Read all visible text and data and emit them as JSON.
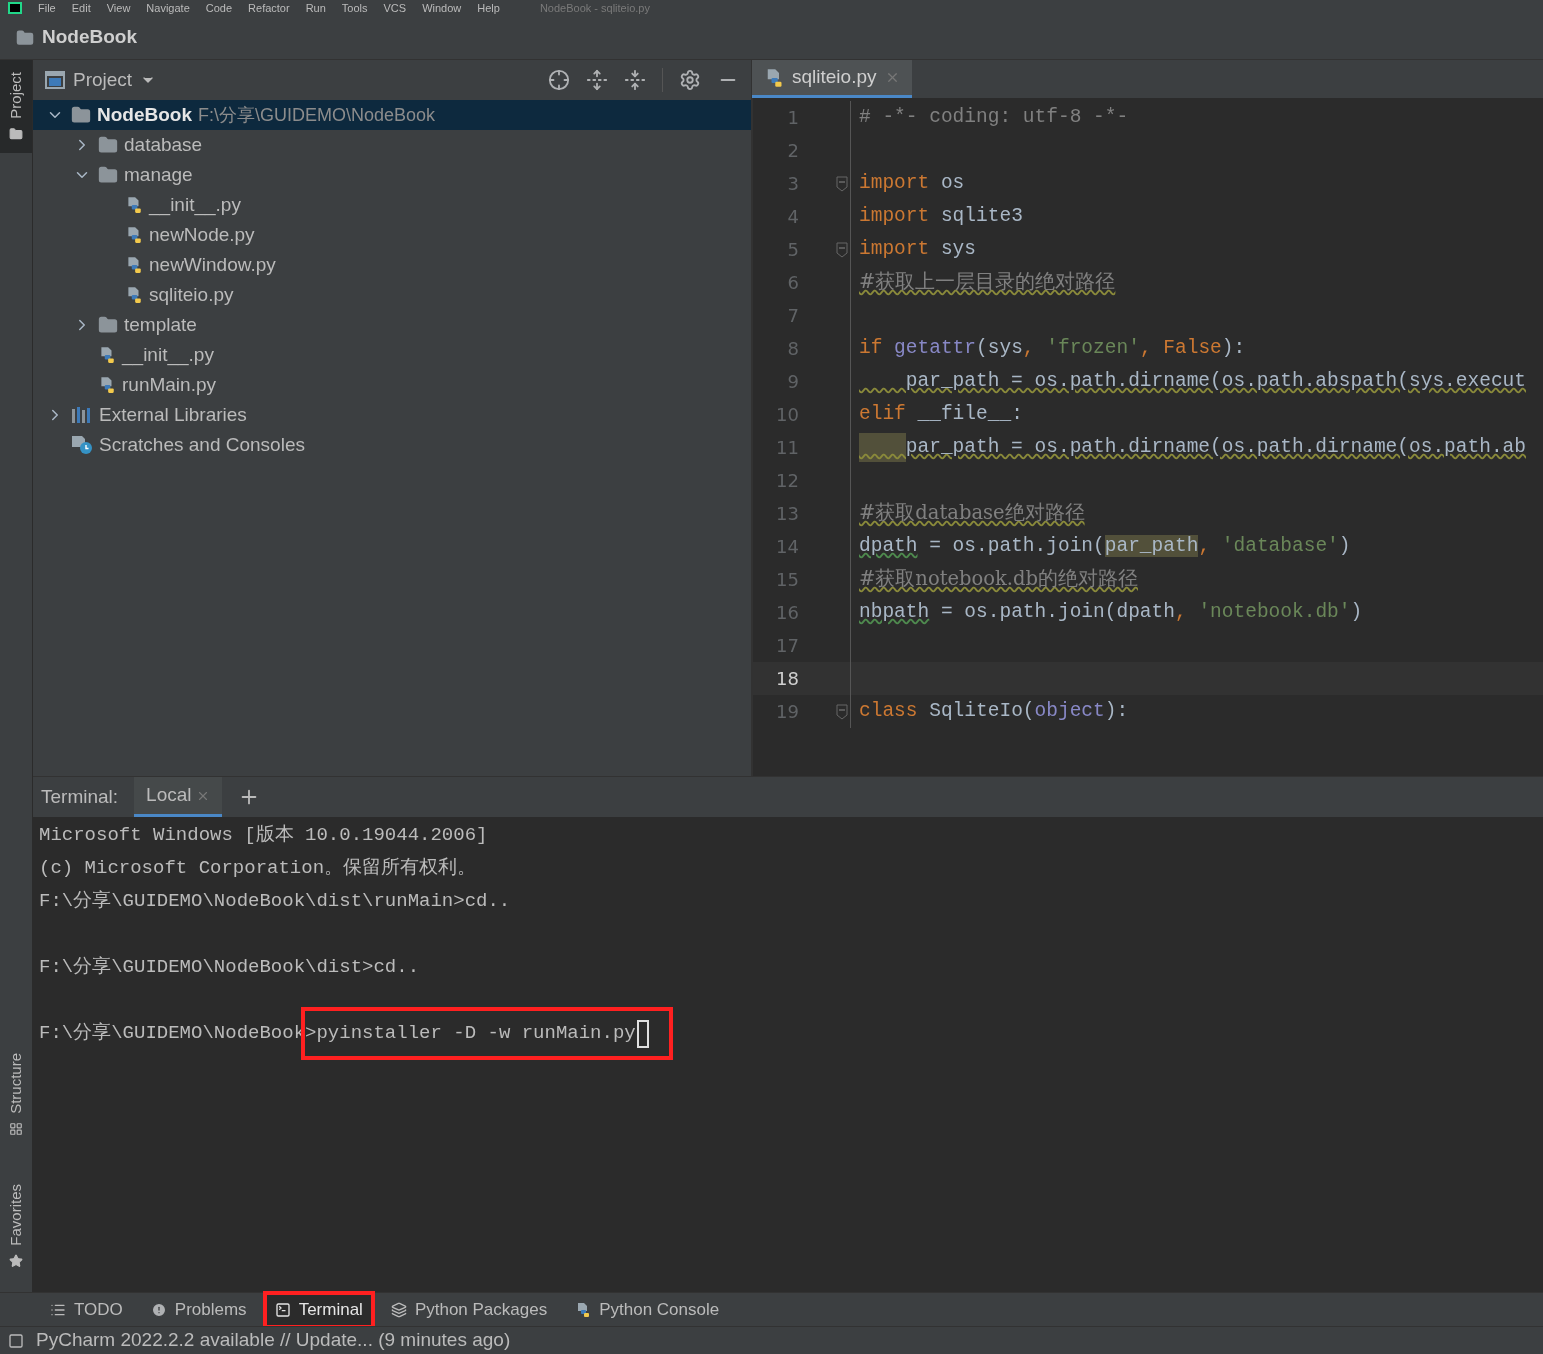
{
  "menu": [
    "File",
    "Edit",
    "View",
    "Navigate",
    "Code",
    "Refactor",
    "Run",
    "Tools",
    "VCS",
    "Window",
    "Help"
  ],
  "window": {
    "title": "NodeBook - sqliteio.py"
  },
  "breadcrumb": "NodeBook",
  "side_tabs": [
    {
      "label": "Project",
      "selected": true
    },
    {
      "label": "Structure",
      "selected": false
    },
    {
      "label": "Favorites",
      "selected": false
    }
  ],
  "project": {
    "title": "Project",
    "tree": [
      {
        "name": "NodeBook",
        "path": "F:\\分享\\GUIDEMO\\NodeBook",
        "kind": "folder",
        "expanded": true,
        "selected": true,
        "children": [
          {
            "name": "database",
            "kind": "folder",
            "expanded": false,
            "selected": false
          },
          {
            "name": "manage",
            "kind": "folder",
            "expanded": true,
            "selected": false,
            "children": [
              {
                "name": "__init__.py",
                "kind": "python",
                "selected": false
              },
              {
                "name": "newNode.py",
                "kind": "python",
                "selected": false
              },
              {
                "name": "newWindow.py",
                "kind": "python",
                "selected": false
              },
              {
                "name": "sqliteio.py",
                "kind": "python",
                "selected": false
              }
            ]
          },
          {
            "name": "template",
            "kind": "folder",
            "expanded": false,
            "selected": false
          },
          {
            "name": "__init__.py",
            "kind": "python",
            "selected": false
          },
          {
            "name": "runMain.py",
            "kind": "python",
            "selected": false
          }
        ]
      },
      {
        "name": "External Libraries",
        "kind": "libraries",
        "expanded": false,
        "selected": false
      },
      {
        "name": "Scratches and Consoles",
        "kind": "scratches",
        "selected": false
      }
    ]
  },
  "editor": {
    "tabs": [
      {
        "label": "sqliteio.py",
        "selected": true
      }
    ],
    "lines": [
      {
        "number": "1",
        "current": false,
        "tokens": [
          {
            "t": "# -*- coding: utf-8 -*-",
            "kind": "comment"
          }
        ]
      },
      {
        "number": "2",
        "current": false
      },
      {
        "number": "3",
        "current": false,
        "fold": true,
        "tokens": [
          {
            "t": "import",
            "kind": "kw"
          },
          {
            "t": " os",
            "kind": "plain"
          }
        ]
      },
      {
        "number": "4",
        "current": false,
        "tokens": [
          {
            "t": "import",
            "kind": "kw"
          },
          {
            "t": " sqlite3",
            "kind": "plain"
          }
        ]
      },
      {
        "number": "5",
        "current": false,
        "fold": true,
        "tokens": [
          {
            "t": "import",
            "kind": "kw"
          },
          {
            "t": " sys",
            "kind": "plain"
          }
        ]
      },
      {
        "number": "6",
        "current": false,
        "tokens": [
          {
            "t": "#获取上一层目录的绝对路径",
            "kind": "cjk"
          }
        ]
      },
      {
        "number": "7",
        "current": false
      },
      {
        "number": "8",
        "current": false,
        "tokens": [
          {
            "t": "if ",
            "kind": "kw"
          },
          {
            "t": "getattr",
            "kind": "builtin"
          },
          {
            "t": "(sys",
            "kind": "plain"
          },
          {
            "t": ", ",
            "kind": "kw"
          },
          {
            "t": "'frozen'",
            "kind": "str"
          },
          {
            "t": ", False",
            "kind": "kw"
          },
          {
            "t": "):",
            "kind": "plain"
          }
        ]
      },
      {
        "number": "9",
        "current": false,
        "tokens": [
          {
            "t": "    par_path = os.path.dirname(os.path.abspath(sys.execut",
            "kind": "warnline"
          }
        ]
      },
      {
        "number": "10",
        "current": false,
        "tokens": [
          {
            "t": "elif ",
            "kind": "kw"
          },
          {
            "t": "__file__:",
            "kind": "plain"
          }
        ]
      },
      {
        "number": "11",
        "current": false,
        "indent_highlighted": true,
        "tokens": [
          {
            "t": "    par_path = os.path.dirname(os.path.dirname(os.path.ab",
            "kind": "warnline"
          }
        ]
      },
      {
        "number": "12",
        "current": false
      },
      {
        "number": "13",
        "current": false,
        "tokens": [
          {
            "t": "#获取database绝对路径",
            "kind": "cjk"
          }
        ]
      },
      {
        "number": "14",
        "current": false,
        "tokens": [
          {
            "t": "dpath",
            "kind": "warn"
          },
          {
            "t": " = os.path.join(",
            "kind": "plain"
          },
          {
            "t": "par_path",
            "kind": "match"
          },
          {
            "t": ", ",
            "kind": "kw"
          },
          {
            "t": "'database'",
            "kind": "str"
          },
          {
            "t": ")",
            "kind": "plain"
          }
        ]
      },
      {
        "number": "15",
        "current": false,
        "tokens": [
          {
            "t": "#获取notebook.db的绝对路径",
            "kind": "cjk"
          }
        ]
      },
      {
        "number": "16",
        "current": false,
        "tokens": [
          {
            "t": "nbpath",
            "kind": "warn"
          },
          {
            "t": " = os.path.join(dpath",
            "kind": "plain"
          },
          {
            "t": ", ",
            "kind": "kw"
          },
          {
            "t": "'notebook.db'",
            "kind": "str"
          },
          {
            "t": ")",
            "kind": "plain"
          }
        ]
      },
      {
        "number": "17",
        "current": false
      },
      {
        "number": "18",
        "current": true
      },
      {
        "number": "19",
        "current": false,
        "fold": true,
        "tokens": [
          {
            "t": "class ",
            "kind": "kw"
          },
          {
            "t": "SqliteIo(",
            "kind": "plain"
          },
          {
            "t": "object",
            "kind": "builtin"
          },
          {
            "t": "):",
            "kind": "plain"
          }
        ]
      }
    ]
  },
  "terminal": {
    "label": "Terminal:",
    "tabs": [
      {
        "label": "Local",
        "selected": true
      }
    ],
    "lines": [
      {
        "kind": "output",
        "text": "Microsoft Windows [版本 10.0.19044.2006]"
      },
      {
        "kind": "output",
        "text": "(c) Microsoft Corporation。保留所有权利。"
      },
      {
        "kind": "output",
        "text": "F:\\分享\\GUIDEMO\\NodeBook\\dist\\runMain>cd.."
      },
      {
        "kind": "blank"
      },
      {
        "kind": "output",
        "text": "F:\\分享\\GUIDEMO\\NodeBook\\dist>cd.."
      },
      {
        "kind": "blank"
      },
      {
        "kind": "input",
        "prompt": "F:\\分享\\GUIDEMO\\NodeBook",
        "command": ">pyinstaller -D -w runMain.py",
        "annotated": true
      }
    ]
  },
  "tool_tabs": [
    {
      "label": "TODO",
      "kind": "list",
      "selected": false,
      "annotated": false
    },
    {
      "label": "Problems",
      "kind": "problems",
      "selected": false,
      "annotated": false
    },
    {
      "label": "Terminal",
      "kind": "terminal",
      "selected": true,
      "annotated": true
    },
    {
      "label": "Python Packages",
      "kind": "packages",
      "selected": false,
      "annotated": false
    },
    {
      "label": "Python Console",
      "kind": "console",
      "selected": false,
      "annotated": false
    }
  ],
  "status_bar": "PyCharm 2022.2.2 available // Update... (9 minutes ago)"
}
